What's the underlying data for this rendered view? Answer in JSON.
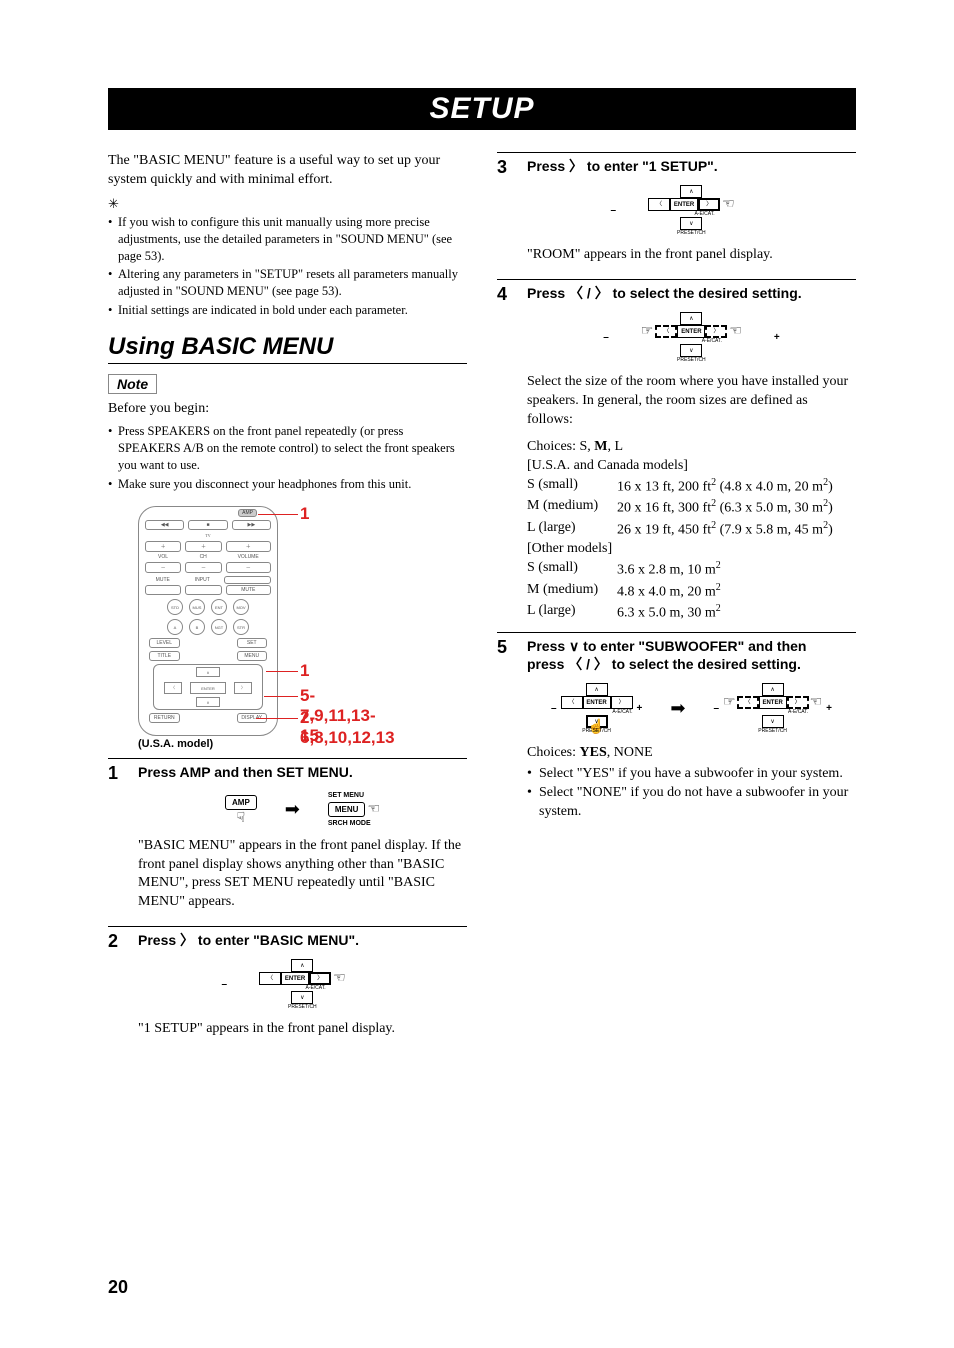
{
  "header": {
    "title": "SETUP"
  },
  "left": {
    "intro": "The \"BASIC MENU\" feature is a useful way to set up your system quickly and with minimal effort.",
    "tip_icon": "✳",
    "tips": [
      "If you wish to configure this unit manually using more precise adjustments, use the detailed parameters in \"SOUND MENU\" (see page 53).",
      "Altering any parameters in \"SETUP\" resets all parameters manually adjusted in \"SOUND MENU\" (see page 53).",
      "Initial settings are indicated in bold under each parameter."
    ],
    "section_title": "Using BASIC MENU",
    "note_label": "Note",
    "before": "Before you begin:",
    "before_items": [
      "Press SPEAKERS on the front panel repeatedly (or press SPEAKERS A/B on the remote control) to select the front speakers you want to use.",
      "Make sure you disconnect your headphones from this unit."
    ],
    "remote": {
      "callouts": {
        "top": "1",
        "mid": "1",
        "mid2": "5-7,9,11,13-15",
        "bot": "2-6,8,10,12,13"
      },
      "caption": "(U.S.A. model)",
      "slider": "AMP"
    },
    "step1": {
      "num": "1",
      "heading": "Press AMP and then SET MENU.",
      "amp_label": "AMP",
      "setmenu_top": "SET MENU",
      "setmenu_mid": "MENU",
      "setmenu_bot": "SRCH MODE",
      "text": "\"BASIC MENU\" appears in the front panel display. If the front panel display shows anything other than \"BASIC MENU\", press SET MENU repeatedly until \"BASIC MENU\" appears."
    },
    "step2": {
      "num": "2",
      "heading_pre": "Press ",
      "heading_post": " to enter \"BASIC MENU\".",
      "enter_label": "ENTER",
      "aecat": "A-E/CAT.",
      "preset": "PRESET/CH",
      "text": "\"1 SETUP\" appears in the front panel display."
    }
  },
  "right": {
    "step3": {
      "num": "3",
      "heading_pre": "Press ",
      "heading_post": " to enter \"1 SETUP\".",
      "text": "\"ROOM\" appears in the front panel display."
    },
    "step4": {
      "num": "4",
      "heading_pre": "Press ",
      "heading_mid": " / ",
      "heading_post": " to select the desired setting.",
      "text": "Select the size of the room where you have installed your speakers. In general, the room sizes are defined as follows:",
      "choices_pre": "Choices: S, ",
      "choices_bold": "M",
      "choices_post": ", L",
      "us_label": "[U.S.A. and Canada models]",
      "s_key": "S (small)",
      "s_val": "16 x 13 ft, 200 ft",
      "s_val2": " (4.8 x 4.0 m, 20 m",
      "m_key": "M (medium)",
      "m_val": "20 x 16 ft, 300 ft",
      "m_val2": " (6.3 x 5.0 m, 30 m",
      "l_key": "L (large)",
      "l_val": "26 x 19 ft, 450 ft",
      "l_val2": " (7.9 x 5.8 m, 45 m",
      "other_label": "[Other models]",
      "os_val": "3.6 x 2.8 m, 10 m",
      "om_val": "4.8 x 4.0 m, 20 m",
      "ol_val": "6.3 x 5.0 m, 30 m"
    },
    "step5": {
      "num": "5",
      "heading_l1_pre": "Press ",
      "heading_l1_post": " to enter \"SUBWOOFER\" and then",
      "heading_l2_pre": "press ",
      "heading_l2_mid": " / ",
      "heading_l2_post": " to select the desired setting.",
      "choices_pre": "Choices: ",
      "choices_bold": "YES",
      "choices_post": ", NONE",
      "bullets": [
        "Select \"YES\" if you have a subwoofer in your system.",
        "Select \"NONE\" if you do not have a subwoofer in your system."
      ]
    },
    "pad": {
      "enter": "ENTER",
      "aecat": "A-E/CAT.",
      "preset": "PRESET/CH"
    }
  },
  "page_number": "20"
}
